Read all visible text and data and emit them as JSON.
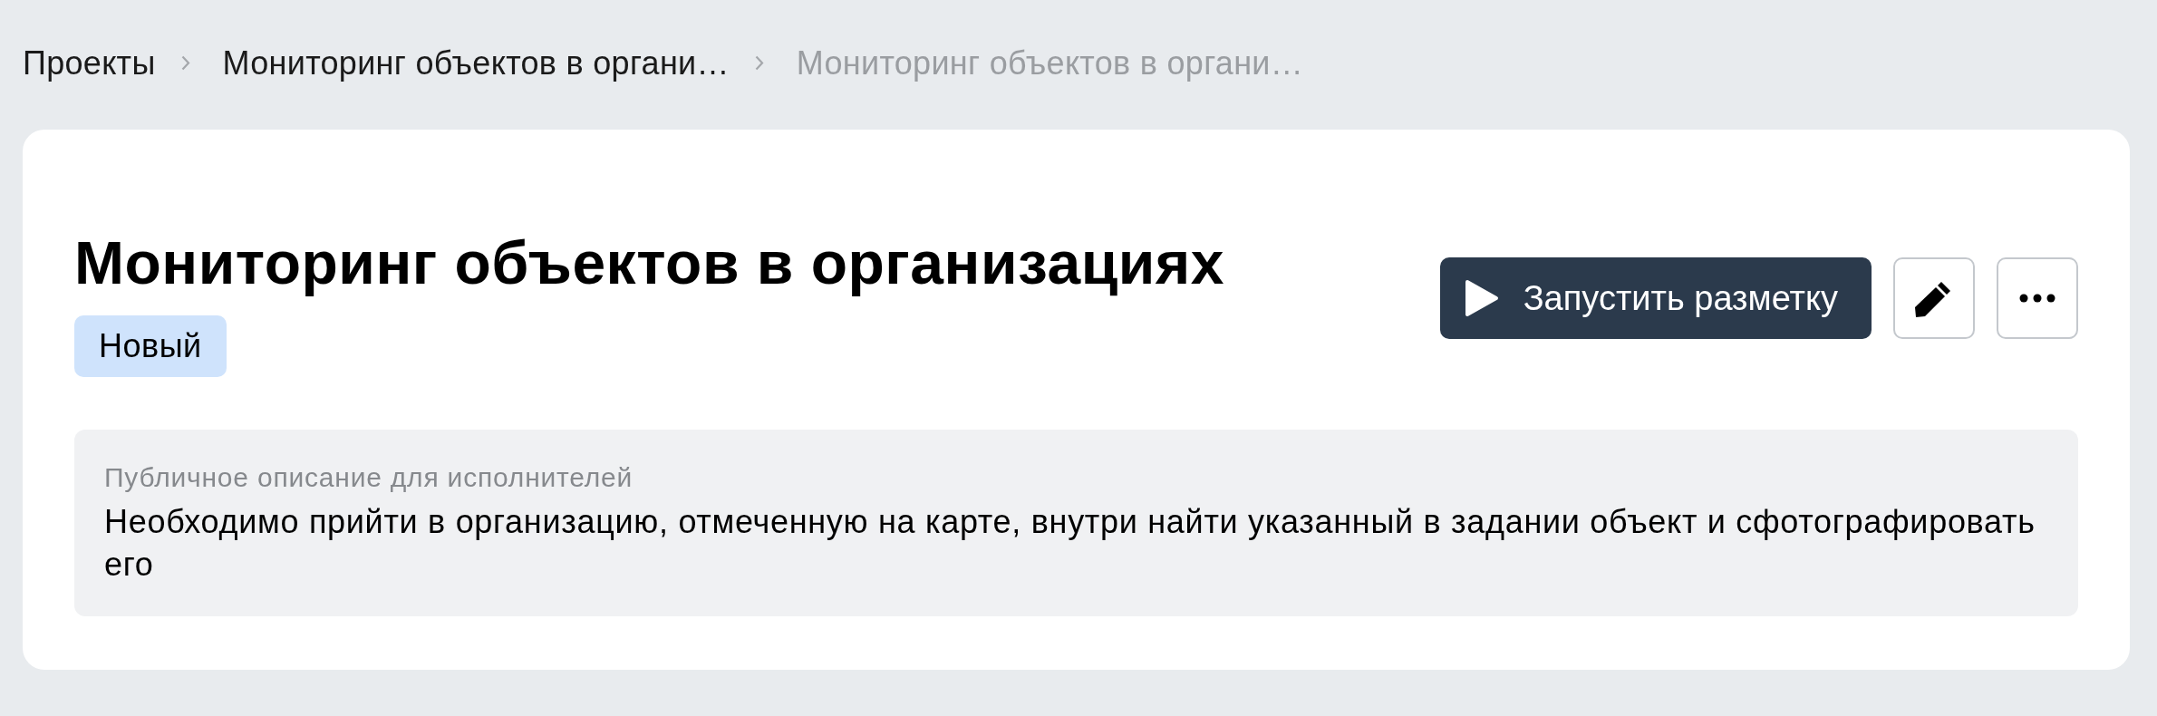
{
  "breadcrumbs": [
    {
      "label": "Проекты",
      "current": false
    },
    {
      "label": "Мониторинг объектов в органи…",
      "current": false
    },
    {
      "label": "Мониторинг объектов в органи…",
      "current": true
    }
  ],
  "project": {
    "title": "Мониторинг объектов в организациях",
    "status": "Новый"
  },
  "actions": [
    {
      "kind": "run",
      "label": "Запустить разметку"
    },
    {
      "kind": "edit"
    },
    {
      "kind": "more"
    }
  ],
  "description": {
    "label": "Публичное описание для исполнителей",
    "text": "Необходимо прийти в организацию, отмеченную на карте, внутри найти указанный в задании объект и сфотографировать его"
  }
}
